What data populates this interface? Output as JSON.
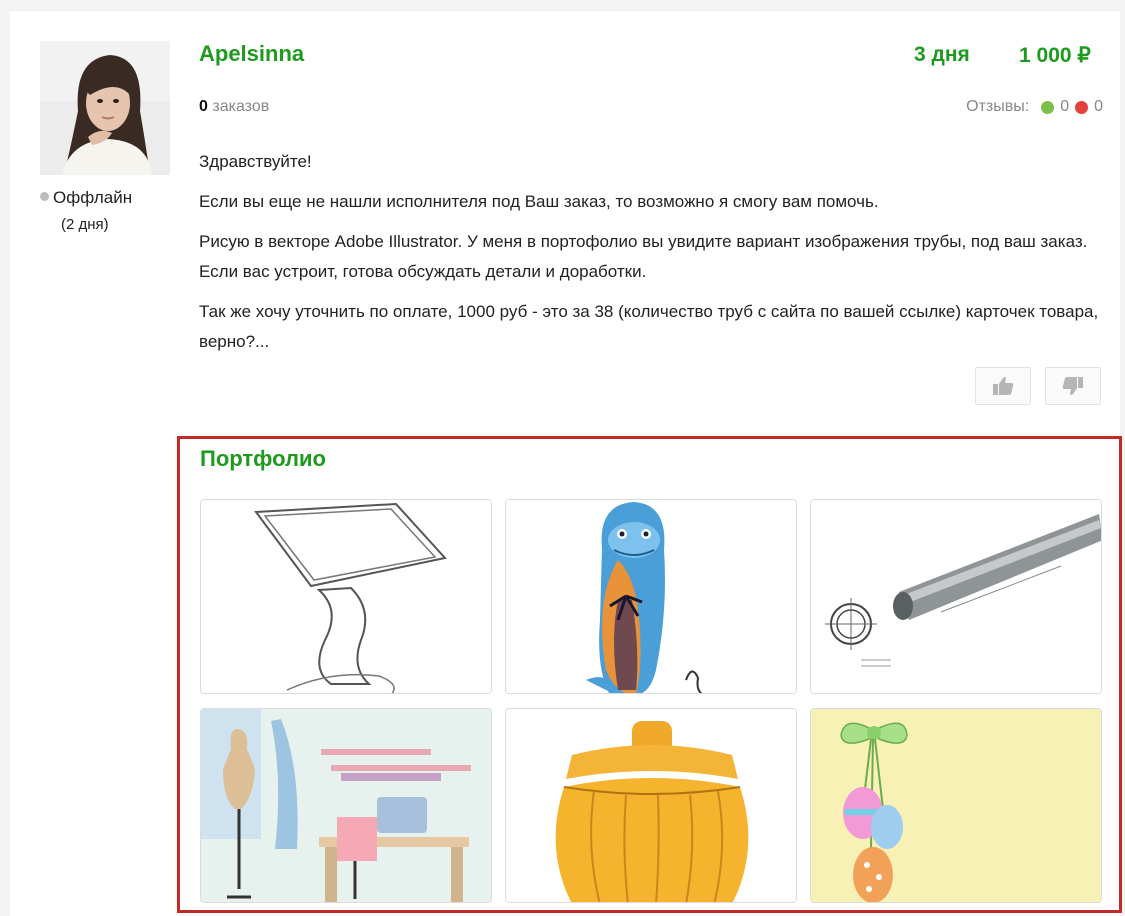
{
  "freelancer": {
    "name": "Apelsinna",
    "status": "Оффлайн",
    "status_sub": "(2 дня)",
    "orders_count": "0",
    "orders_label": "заказов",
    "reviews_label": "Отзывы:",
    "reviews_positive": "0",
    "reviews_negative": "0"
  },
  "offer": {
    "days": "3 дня",
    "price": "1 000 ₽"
  },
  "message": {
    "p1": "Здравствуйте!",
    "p2": "Если вы еще не нашли исполнителя под Ваш заказ, то возможно я смогу вам помочь.",
    "p3": "Рисую в векторе Adobe Illustrator. У меня в портофолио вы увидите вариант изображения трубы, под ваш заказ. Если вас устроит, готова обсуждать детали и доработки.",
    "p4": "Так же хочу уточнить по оплате, 1000 руб - это за 38 (количество труб с сайта по вашей ссылке) карточек товара, верно?..."
  },
  "portfolio": {
    "title": "Портфолио",
    "items": [
      "kiosk-stand-drawing",
      "dolphin-surfboard-illustration",
      "steel-pipe-drawing",
      "sewing-room-illustration",
      "wooden-barrel-illustration",
      "easter-eggs-illustration"
    ]
  },
  "colors": {
    "accent_green": "#1e9a1e",
    "highlight_red": "#c22b25",
    "positive": "#7cc04b",
    "negative": "#e4403d"
  },
  "icons": {
    "vote_up": "thumbs-up-icon",
    "vote_down": "thumbs-down-icon",
    "status": "status-dot-icon"
  }
}
